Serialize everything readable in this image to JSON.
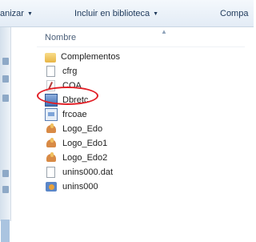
{
  "toolbar": {
    "organize_label": "anizar",
    "library_label": "Incluir en biblioteca",
    "share_label": "Compa",
    "dropdown_glyph": "▼"
  },
  "header": {
    "name_column": "Nombre"
  },
  "files": [
    {
      "name": "Complementos",
      "icon": "folder-icon"
    },
    {
      "name": "cfrg",
      "icon": "file-icon"
    },
    {
      "name": "COA",
      "icon": "access-file-icon"
    },
    {
      "name": "Dbretc",
      "icon": "database-icon"
    },
    {
      "name": "frcoae",
      "icon": "form-icon"
    },
    {
      "name": "Logo_Edo",
      "icon": "image-icon"
    },
    {
      "name": "Logo_Edo1",
      "icon": "image-icon"
    },
    {
      "name": "Logo_Edo2",
      "icon": "image-icon"
    },
    {
      "name": "unins000.dat",
      "icon": "file-icon"
    },
    {
      "name": "unins000",
      "icon": "setup-icon"
    }
  ],
  "colors": {
    "highlight": "#e21f26",
    "toolbar_text": "#1e395b"
  }
}
